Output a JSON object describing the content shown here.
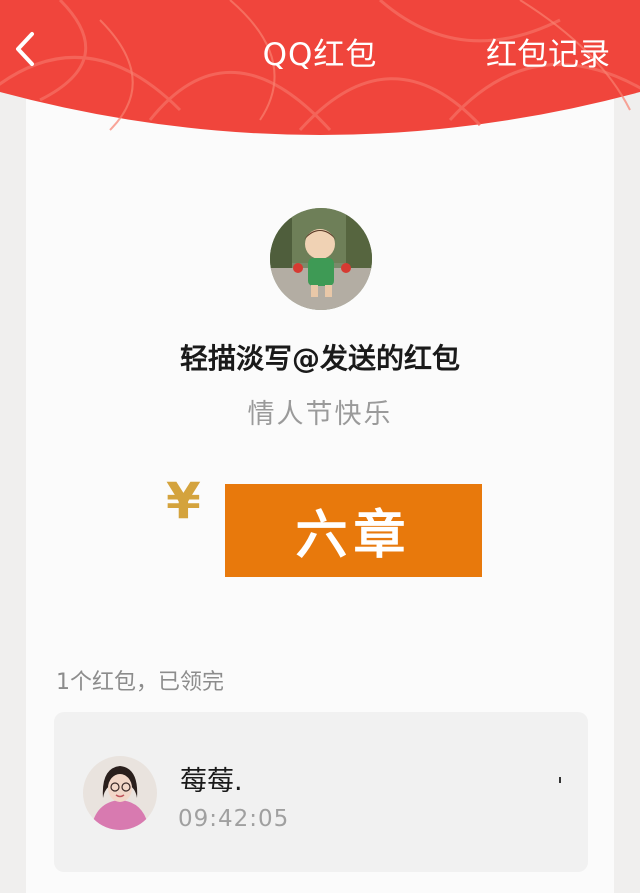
{
  "header": {
    "back_icon": "chevron-left-icon",
    "title": "QQ红包",
    "records_label": "红包记录",
    "color": "#f0453c"
  },
  "packet": {
    "sender_line": "轻描淡写@发送的红包",
    "wish": "情人节快乐",
    "currency_symbol": "¥",
    "amount": "六章",
    "amount_color": "#e8790c"
  },
  "summary": {
    "status": "1个红包，已领完"
  },
  "receivers": [
    {
      "name": "莓莓.",
      "time": "09:42:05"
    }
  ]
}
